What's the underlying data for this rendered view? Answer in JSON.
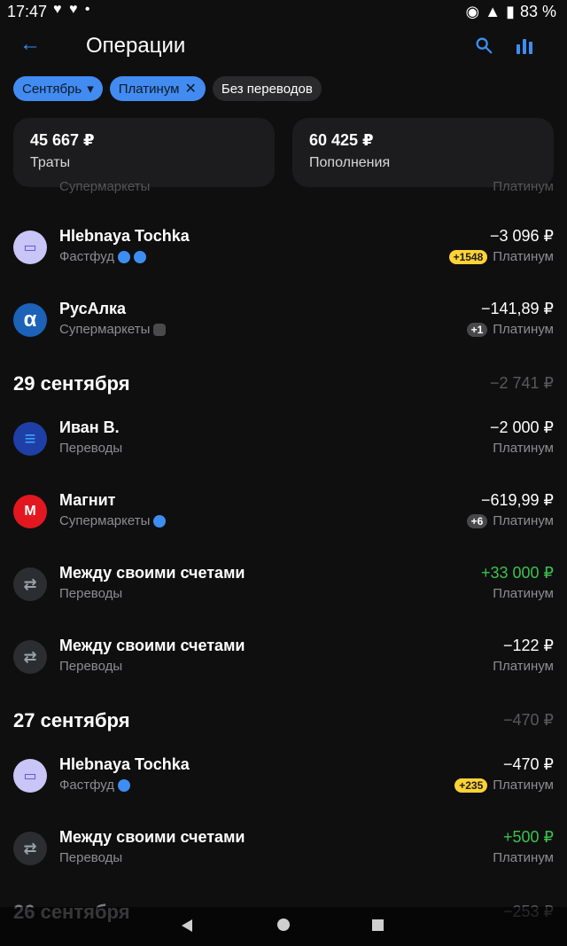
{
  "status": {
    "time": "17:47",
    "hearts": "♥ ♥ •",
    "battery": "83 %"
  },
  "header": {
    "title": "Операции"
  },
  "filters": {
    "month": "Сентябрь",
    "card": "Платинум",
    "transfers": "Без переводов"
  },
  "summary": {
    "spend_amount": "45 667 ₽",
    "spend_label": "Траты",
    "income_amount": "60 425 ₽",
    "income_label": "Пополнения"
  },
  "partial": {
    "category": "Супермаркеты",
    "account": "Платинум"
  },
  "rows": [
    {
      "name": "Hlebnaya Tochka",
      "category": "Фастфуд",
      "amount": "−3 096 ₽",
      "badge": "+1548",
      "account": "Платинум"
    },
    {
      "name": "РусАлка",
      "category": "Супермаркеты",
      "amount": "−141,89 ₽",
      "badge": "+1",
      "account": "Платинум"
    },
    {
      "date": "29 сентября",
      "total": "−2 741 ₽"
    },
    {
      "name": "Иван В.",
      "category": "Переводы",
      "amount": "−2 000 ₽",
      "account": "Платинум"
    },
    {
      "name": "Магнит",
      "category": "Супермаркеты",
      "amount": "−619,99 ₽",
      "badge": "+6",
      "account": "Платинум"
    },
    {
      "name": "Между своими счетами",
      "category": "Переводы",
      "amount": "+33 000 ₽",
      "account": "Платинум"
    },
    {
      "name": "Между своими счетами",
      "category": "Переводы",
      "amount": "−122 ₽",
      "account": "Платинум"
    },
    {
      "date": "27 сентября",
      "total": "−470 ₽"
    },
    {
      "name": "Hlebnaya Tochka",
      "category": "Фастфуд",
      "amount": "−470 ₽",
      "badge": "+235",
      "account": "Платинум"
    },
    {
      "name": "Между своими счетами",
      "category": "Переводы",
      "amount": "+500 ₽",
      "account": "Платинум"
    },
    {
      "date": "26 сентября",
      "total": "−253 ₽"
    }
  ]
}
